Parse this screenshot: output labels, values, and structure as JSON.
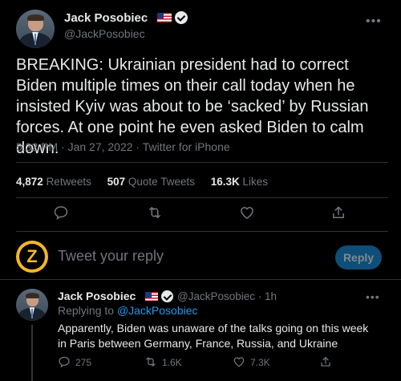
{
  "main_tweet": {
    "author_name": "Jack Posobiec",
    "author_handle": "@JackPosobiec",
    "text": "BREAKING: Ukrainian president had to correct Biden multiple times on their call today when he insisted Kyiv was about to be ‘sacked’ by Russian forces. At one point he even asked Biden to calm down.",
    "meta": "5:32 PM · Jan 27, 2022 · Twitter for iPhone",
    "stats": {
      "retweets_count": "4,872",
      "retweets_label": "Retweets",
      "quotes_count": "507",
      "quotes_label": "Quote Tweets",
      "likes_count": "16.3K",
      "likes_label": "Likes"
    }
  },
  "composer": {
    "placeholder": "Tweet your reply",
    "reply_button": "Reply"
  },
  "reply_tweet": {
    "author_name": "Jack Posobiec",
    "author_handle": "@JackPosobiec",
    "separator": "·",
    "time": "1h",
    "replying_prefix": "Replying to",
    "replying_handle": "@JackPosobiec",
    "text": "Apparently, Biden was unaware of the talks going on this week in Paris between Germany, France, Russia, and Ukraine",
    "reply_count": "275",
    "retweet_count": "1.6K",
    "like_count": "7.3K"
  },
  "icons": [
    "flag-us-icon",
    "verified-icon",
    "more-icon",
    "reply-icon",
    "retweet-icon",
    "like-icon",
    "share-icon"
  ],
  "colors": {
    "background": "#000000",
    "text": "#e7e9ea",
    "muted": "#71767b",
    "accent": "#1d9bf0",
    "divider": "#2f3336"
  }
}
